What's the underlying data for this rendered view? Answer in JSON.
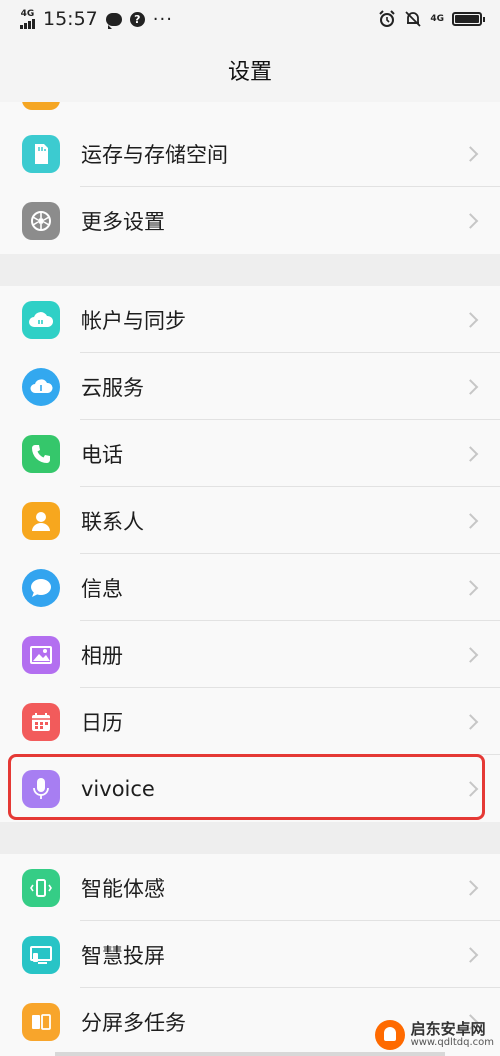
{
  "status_bar": {
    "network_label": "4G",
    "time": "15:57",
    "more": "···",
    "network_right": "4G",
    "icons": [
      "signal-icon",
      "chat-bubble-icon",
      "question-icon",
      "alarm-icon",
      "mute-bell-icon",
      "battery-icon"
    ]
  },
  "header": {
    "title": "设置"
  },
  "section_a": {
    "items": [
      {
        "label": "运存与存储空间",
        "icon": "storage-card-icon",
        "color": "#3ccbd0"
      },
      {
        "label": "更多设置",
        "icon": "gear-icon",
        "color": "#8c8c8c"
      }
    ]
  },
  "section_b": {
    "items": [
      {
        "label": "帐户与同步",
        "icon": "cloud-sync-icon",
        "color": "#2fd0c6"
      },
      {
        "label": "云服务",
        "icon": "cloud-icon",
        "color": "#33a8ef"
      },
      {
        "label": "电话",
        "icon": "phone-icon",
        "color": "#35c76b"
      },
      {
        "label": "联系人",
        "icon": "contact-person-icon",
        "color": "#f7a71e"
      },
      {
        "label": "信息",
        "icon": "message-bubble-icon",
        "color": "#33a4ef"
      },
      {
        "label": "相册",
        "icon": "photo-album-icon",
        "color": "#b36ff0"
      },
      {
        "label": "日历",
        "icon": "calendar-icon",
        "color": "#f25b5b"
      },
      {
        "label": "vivoice",
        "icon": "microphone-icon",
        "color": "#a77ef2"
      }
    ]
  },
  "section_c": {
    "items": [
      {
        "label": "智能体感",
        "icon": "motion-phone-icon",
        "color": "#35cd86"
      },
      {
        "label": "智慧投屏",
        "icon": "screen-cast-icon",
        "color": "#28c4c6"
      },
      {
        "label": "分屏多任务",
        "icon": "split-screen-icon",
        "color": "#f8a52b"
      }
    ]
  },
  "watermark": {
    "title": "启东安卓网",
    "url": "www.qdltdq.com"
  }
}
